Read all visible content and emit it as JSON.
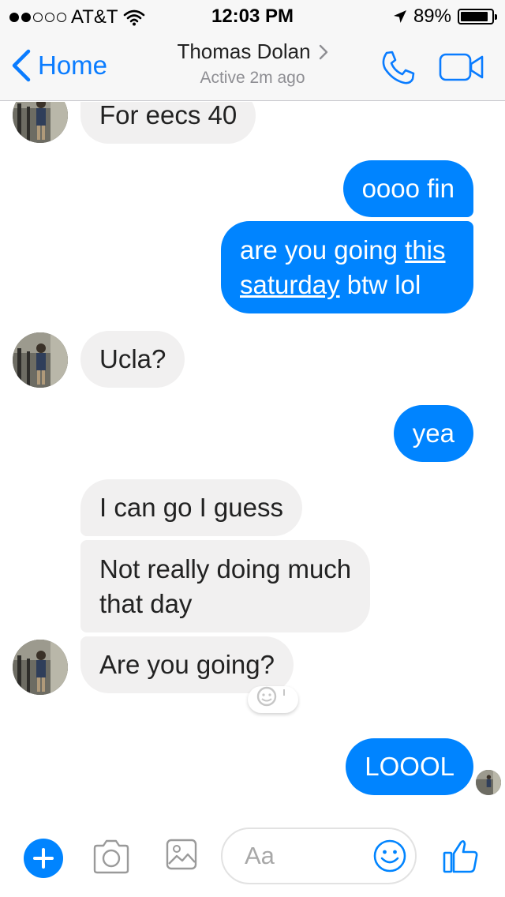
{
  "status_bar": {
    "carrier": "AT&T",
    "time": "12:03 PM",
    "battery": "89%",
    "battery_level": 0.89,
    "signal_bars_filled": 2,
    "signal_bars_total": 5
  },
  "header": {
    "back_label": "Home",
    "contact_name": "Thomas Dolan",
    "contact_status": "Active 2m ago"
  },
  "messages": [
    {
      "from": "them",
      "text": "For eecs 40"
    },
    {
      "from": "me",
      "text": "oooo fin"
    },
    {
      "from": "me",
      "text_before_link": "are you going ",
      "link_text_1": "this",
      "link_text_2": "saturday",
      "text_after_link": " btw lol"
    },
    {
      "from": "them",
      "text": "Ucla?"
    },
    {
      "from": "me",
      "text": "yea"
    },
    {
      "from": "them",
      "text": "I can go I guess"
    },
    {
      "from": "them",
      "text_line1": "Not really doing much",
      "text_line2": "that day"
    },
    {
      "from": "them",
      "text": "Are you going?"
    },
    {
      "from": "me",
      "text": "LOOOL"
    }
  ],
  "composer": {
    "placeholder": "Aa"
  },
  "colors": {
    "accent": "#0084ff",
    "link_blue": "#0a7cff",
    "incoming_bubble": "#f1f0f0",
    "outgoing_bubble": "#0084ff"
  },
  "icons": [
    "chevron-left-icon",
    "chevron-right-icon",
    "phone-icon",
    "video-camera-icon",
    "plus-icon",
    "camera-icon",
    "image-icon",
    "emoji-icon",
    "thumbs-up-icon",
    "checkmark-icon",
    "location-arrow-icon",
    "wifi-icon"
  ]
}
